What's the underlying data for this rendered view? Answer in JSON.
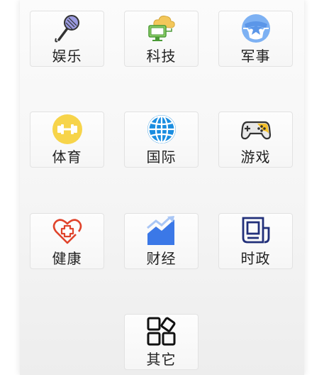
{
  "categories": [
    {
      "label": "娱乐",
      "icon": "microphone-icon"
    },
    {
      "label": "科技",
      "icon": "cloud-computer-icon"
    },
    {
      "label": "军事",
      "icon": "star-badge-icon"
    },
    {
      "label": "体育",
      "icon": "dumbbell-icon"
    },
    {
      "label": "国际",
      "icon": "globe-icon"
    },
    {
      "label": "游戏",
      "icon": "gamepad-icon"
    },
    {
      "label": "健康",
      "icon": "heart-cross-icon"
    },
    {
      "label": "财经",
      "icon": "trend-chart-icon"
    },
    {
      "label": "时政",
      "icon": "newspaper-icon"
    },
    {
      "label": "其它",
      "icon": "apps-grid-icon"
    }
  ]
}
